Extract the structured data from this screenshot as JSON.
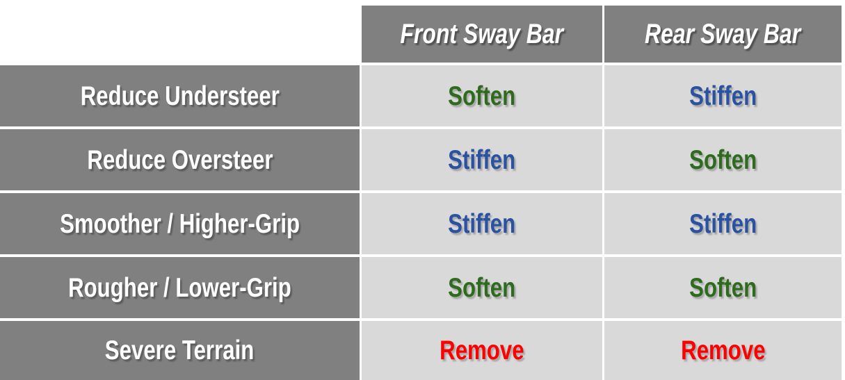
{
  "table": {
    "corner_label": "",
    "columns": [
      {
        "id": "front-sway-bar",
        "label": "Front Sway Bar"
      },
      {
        "id": "rear-sway-bar",
        "label": "Rear Sway Bar"
      }
    ],
    "rows": [
      {
        "id": "reduce-understeer",
        "label": "Reduce Understeer",
        "front": {
          "text": "Soften",
          "color": "#2e6b1e"
        },
        "rear": {
          "text": "Stiffen",
          "color": "#2a52a0"
        }
      },
      {
        "id": "reduce-oversteer",
        "label": "Reduce Oversteer",
        "front": {
          "text": "Stiffen",
          "color": "#2a52a0"
        },
        "rear": {
          "text": "Soften",
          "color": "#2e6b1e"
        }
      },
      {
        "id": "smoother-higher-grip",
        "label": "Smoother / Higher-Grip",
        "front": {
          "text": "Stiffen",
          "color": "#2a52a0"
        },
        "rear": {
          "text": "Stiffen",
          "color": "#2a52a0"
        }
      },
      {
        "id": "rougher-lower-grip",
        "label": "Rougher / Lower-Grip",
        "front": {
          "text": "Soften",
          "color": "#2e6b1e"
        },
        "rear": {
          "text": "Soften",
          "color": "#2e6b1e"
        }
      },
      {
        "id": "severe-terrain",
        "label": "Severe Terrain",
        "front": {
          "text": "Remove",
          "color": "#ff0000"
        },
        "rear": {
          "text": "Remove",
          "color": "#ff0000"
        }
      }
    ]
  },
  "colors": {
    "header_bg": "#808080",
    "label_bg": "#808080",
    "value_bg": "#d9d9d9",
    "page_bg": "#ffffff",
    "header_text": "#ffffff",
    "label_text": "#ffffff",
    "soften": "#2e6b1e",
    "stiffen": "#2a52a0",
    "remove": "#ff0000"
  }
}
